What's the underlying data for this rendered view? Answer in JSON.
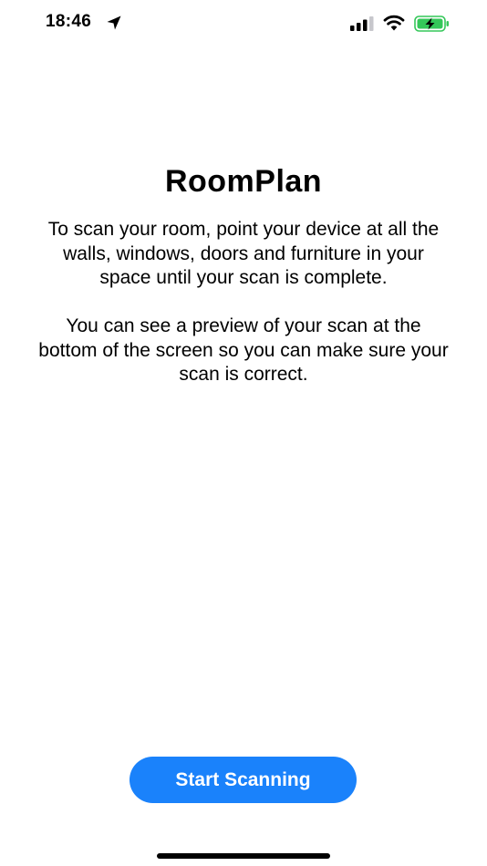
{
  "status_bar": {
    "time": "18:46",
    "icons": [
      "location-arrow-icon",
      "cellular-signal-icon",
      "wifi-icon",
      "battery-charging-icon"
    ],
    "battery_color": "#34c759"
  },
  "main": {
    "title": "RoomPlan",
    "paragraphs": [
      "To scan your room, point your device at all the walls, windows, doors and furniture in your space until your scan is complete.",
      "You can see a preview of your scan at the bottom of the screen so you can make sure your scan is correct."
    ]
  },
  "actions": {
    "start_label": "Start Scanning",
    "accent_color": "#1a82fb"
  }
}
